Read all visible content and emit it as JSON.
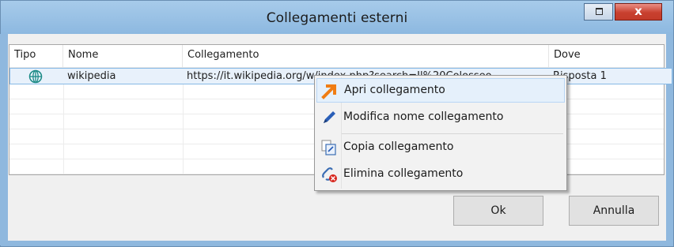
{
  "window": {
    "title": "Collegamenti esterni",
    "close_glyph": "x",
    "restore_icon": "restore-icon",
    "close_icon": "close-icon"
  },
  "table": {
    "columns": [
      "Tipo",
      "Nome",
      "Collegamento",
      "Dove"
    ],
    "rows": [
      {
        "type_icon": "globe-icon",
        "nome": "wikipedia",
        "collegamento": "https://it.wikipedia.org/w/index.php?search=Il%20Colosseo",
        "dove": "Risposta 1"
      }
    ]
  },
  "context_menu": {
    "items": [
      {
        "label": "Apri collegamento",
        "icon": "open-arrow-icon"
      },
      {
        "label": "Modifica nome collegamento",
        "icon": "pencil-icon"
      },
      {
        "label": "Copia collegamento",
        "icon": "copy-icon"
      },
      {
        "label": "Elimina collegamento",
        "icon": "delete-link-icon"
      }
    ]
  },
  "buttons": {
    "ok": "Ok",
    "cancel": "Annulla"
  },
  "colors": {
    "titlebar": "#8fb8de",
    "close_button": "#c8402f",
    "selection": "#e8f1fb"
  }
}
